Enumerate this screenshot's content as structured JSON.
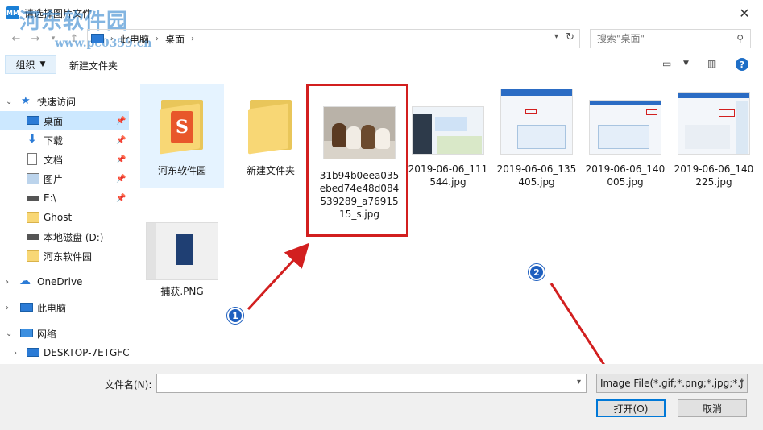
{
  "window": {
    "title": "请选择图片文件",
    "app_icon": "MM"
  },
  "watermark": {
    "text": "河东软件园",
    "url": "www.pc0359.cn"
  },
  "address": {
    "segments": [
      "此电脑",
      "桌面"
    ]
  },
  "search": {
    "placeholder": "搜索\"桌面\""
  },
  "toolbar": {
    "organize": "组织",
    "new_folder": "新建文件夹"
  },
  "sidebar": {
    "items": [
      {
        "label": "快速访问",
        "icon": "star-icon"
      },
      {
        "label": "桌面",
        "icon": "desktop-icon",
        "pinned": true,
        "selected": true
      },
      {
        "label": "下载",
        "icon": "download-icon",
        "pinned": true
      },
      {
        "label": "文档",
        "icon": "document-icon",
        "pinned": true
      },
      {
        "label": "图片",
        "icon": "picture-icon",
        "pinned": true
      },
      {
        "label": "E:\\",
        "icon": "drive-icon",
        "pinned": true
      },
      {
        "label": "Ghost",
        "icon": "folder-icon"
      },
      {
        "label": "本地磁盘 (D:)",
        "icon": "drive-icon"
      },
      {
        "label": "河东软件园",
        "icon": "folder-icon"
      },
      {
        "label": "OneDrive",
        "icon": "cloud-icon"
      },
      {
        "label": "此电脑",
        "icon": "pc-icon"
      },
      {
        "label": "网络",
        "icon": "network-icon"
      },
      {
        "label": "DESKTOP-7ETGFC",
        "icon": "computer-icon"
      }
    ]
  },
  "files": [
    {
      "name": "河东软件园",
      "type": "folder"
    },
    {
      "name": "新建文件夹",
      "type": "folder"
    },
    {
      "name": "31b94b0eea035ebed74e48d084539289_a7691515_s.jpg",
      "type": "image"
    },
    {
      "name": "2019-06-06_111544.jpg",
      "type": "image"
    },
    {
      "name": "2019-06-06_135405.jpg",
      "type": "image"
    },
    {
      "name": "2019-06-06_140005.jpg",
      "type": "image"
    },
    {
      "name": "2019-06-06_140225.jpg",
      "type": "image"
    },
    {
      "name": "捕获.PNG",
      "type": "image"
    }
  ],
  "annotations": {
    "badge1": "1",
    "badge2": "2",
    "color": "#d21f1f"
  },
  "bottom": {
    "filename_label": "文件名(N):",
    "filename_value": "",
    "filter": "Image File(*.gif;*.png;*.jpg;*.j",
    "open": "打开(O)",
    "cancel": "取消"
  },
  "colors": {
    "accent": "#0078d7",
    "selection": "#cce8ff",
    "folder": "#f8d775"
  }
}
